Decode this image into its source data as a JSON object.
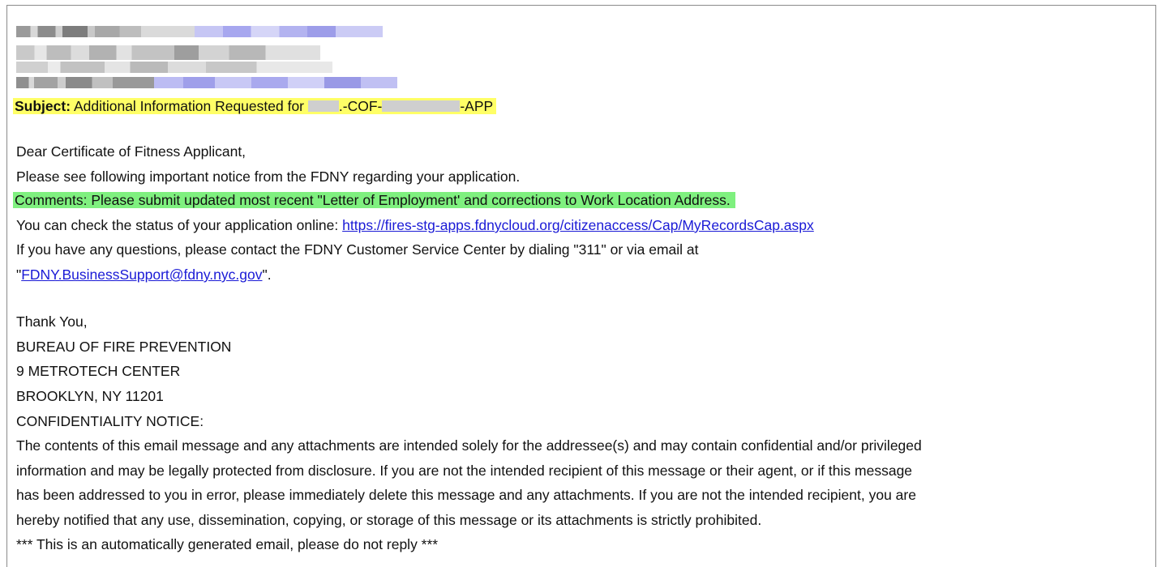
{
  "email": {
    "subject_label": "Subject:",
    "subject_text_prefix": "Additional Information Requested for",
    "subject_mid": ".-COF-",
    "subject_suffix": "-APP",
    "greeting": "Dear Certificate of Fitness Applicant,",
    "notice_line": "Please see following important notice from the FDNY regarding your application.",
    "comments_line": "Comments: Please submit updated most recent \"Letter of Employment' and corrections to Work Location Address.",
    "status_prefix": "You can check the status of your application online: ",
    "status_link": "https://fires-stg-apps.fdnycloud.org/citizenaccess/Cap/MyRecordsCap.aspx",
    "questions_line": "If you have any questions, please contact the FDNY Customer Service Center by dialing \"311\" or via email at",
    "email_quote_open": "\"",
    "email_link": "FDNY.BusinessSupport@fdny.nyc.gov",
    "email_quote_close": "\".",
    "thanks": "Thank You,",
    "bureau": "BUREAU OF FIRE PREVENTION",
    "street": "9 METROTECH CENTER",
    "city": "BROOKLYN, NY 11201",
    "confidentiality_heading": "CONFIDENTIALITY NOTICE:",
    "confidentiality_1": "The contents of this email message and any attachments are intended solely for the addressee(s) and may contain confidential and/or privileged",
    "confidentiality_2": "information and may be legally protected from disclosure. If you are not the intended recipient of this message or their agent, or if this message",
    "confidentiality_3": "has been addressed to you in error, please immediately delete this message and any attachments. If you are not the intended recipient, you are",
    "confidentiality_4": "hereby notified that any use, dissemination, copying, or storage of this message or its attachments is strictly prohibited.",
    "auto_notice": "*** This is an automatically generated email, please do not reply ***"
  },
  "colors": {
    "subject_highlight": "#ffff66",
    "comments_highlight": "#7ff07f",
    "link": "#1a1ad6"
  }
}
